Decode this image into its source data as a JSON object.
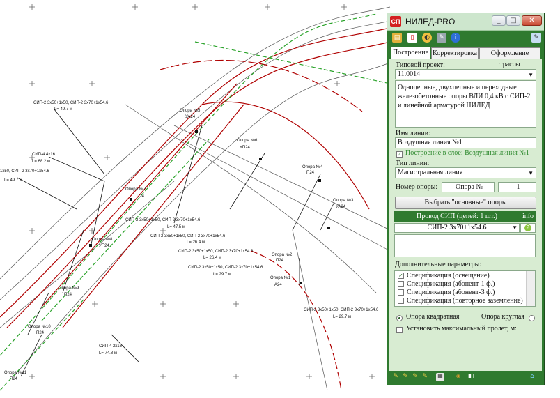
{
  "window": {
    "title": "НИЛЕД-PRO",
    "app_icon_text": "СП",
    "minimize_icon": "minimize-icon",
    "maximize_icon": "maximize-icon",
    "close_icon": "close-icon"
  },
  "toolbar": {
    "icons": [
      "open-folder-icon",
      "document-icon",
      "palette-icon",
      "tools-icon",
      "info-icon",
      "pencil-settings-icon"
    ]
  },
  "tabs": [
    "Построение",
    "Корректировка",
    "Оформление трассы"
  ],
  "form": {
    "typical_project_label": "Типовой проект:",
    "typical_project_value": "11.0014",
    "description": "Одноцепные, двухцепные и переходные железобетонные опоры ВЛИ 0,4 кВ с СИП-2 и линейной арматурой НИЛЕД",
    "line_name_label": "Имя линии:",
    "line_name_value": "Воздушная линия №1",
    "layer_check_label": "Построение в слое: Воздушная линия №1",
    "line_type_label": "Тип линии:",
    "line_type_value": "Магистральная линия",
    "pole_number_label": "Номер опоры:",
    "pole_prefix_value": "Опора №",
    "pole_number_value": "1",
    "select_button": "Выбрать \"основные\" опоры",
    "wire_header": "Провод СИП (цепей: 1 шт.)",
    "info_header": "info",
    "wire_value": "СИП-2 3х70+1х54.6",
    "extra_params_label": "Дополнительные параметры:",
    "specs": [
      {
        "label": "Спецификация (освещение)",
        "checked": true
      },
      {
        "label": "Спецификация (абонент-1 ф.)",
        "checked": false
      },
      {
        "label": "Спецификация (абонент-3 ф.)",
        "checked": false
      },
      {
        "label": "Спецификация (повторное заземление)",
        "checked": false
      }
    ],
    "radio_square": "Опора квадратная",
    "radio_round": "Опора круглая",
    "max_span_label": "Установить максимальный пролет, м:"
  },
  "bottombar": {
    "icons": [
      "draw-pencil-icon",
      "draw-pencil2-icon",
      "draw-pencil3-icon",
      "draw-pencil4-icon",
      "chart-icon",
      "paint-bucket-icon",
      "eraser-icon",
      "home-icon"
    ]
  },
  "drawing": {
    "labels": [
      "СИП-2 3х50+1х50, СИП-2 3х70+1х54.6",
      "L= 49.7 м",
      "СИП-4 4х16",
      "L= 68.2 м",
      "1х50, СИП-2 3х70+1х54.6",
      "L= 49.7 м",
      "СИП-2 3х50+1х50, СИП-2 3х70+1х54.6",
      "L= 47.5 м",
      "СИП-2 3х50+1х50, СИП-2 3х70+1х54.6",
      "L= 26.4 м",
      "СИП-2 3х50+1х50, СИП-2 3х70+1х54.6",
      "L= 26.4 м",
      "СИП-2 3х50+1х50, СИП-2 3х70+1х54.6",
      "L= 29.7 м",
      "СИП-2 3х50+1х50, СИП-2 3х70+1х54.6",
      "L= 29.7 м",
      "СИП-4 2х16",
      "L= 74.8 м",
      "Опора №5",
      "УА24",
      "Опора №6",
      "УП24",
      "Опора №4",
      "П24",
      "Опора №3",
      "УА24",
      "Опора №2",
      "П24",
      "Опора №1",
      "А24",
      "Опора №8",
      "УП24",
      "Опора №9",
      "П24",
      "Опора №10",
      "П24",
      "Опора №11",
      "П24",
      "Опора №7",
      "П24"
    ]
  }
}
